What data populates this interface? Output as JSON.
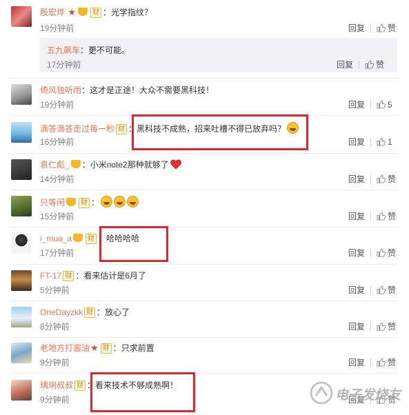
{
  "actions": {
    "reply": "回复",
    "like": "赞"
  },
  "comments": [
    {
      "user": "殷宏烨",
      "text": "光学指纹？",
      "time": "19分钟前",
      "likes": "赞",
      "reply": {
        "user": "五九飙车",
        "text": "更不可能。",
        "time": "17分钟前",
        "likes": "赞"
      }
    },
    {
      "user": "倚风独听雨",
      "text": "这才是正途！大众不需要黑科技！",
      "time": "19分钟前",
      "likes": "5"
    },
    {
      "user": "滴答滴答走过每一秒",
      "text": "黑科技不成熟，招来吐槽不得已放弃吗？",
      "time": "16分钟前",
      "likes": "1"
    },
    {
      "user": "袁仁彪_",
      "text": "小米note2那种就够了",
      "time": "14分钟前",
      "likes": "赞"
    },
    {
      "user": "只等闲",
      "text": "",
      "time": "15分钟前",
      "likes": "赞"
    },
    {
      "user": "i_mua_a",
      "text": "哈哈哈哈",
      "time": "17分钟前",
      "likes": "赞"
    },
    {
      "user": "FT-17",
      "text": "看来估计是6月了",
      "time": "5分钟前",
      "likes": "赞"
    },
    {
      "user": "OneDayzkk",
      "text": "放心了",
      "time": "8分钟前",
      "likes": "赞"
    },
    {
      "user": "老地方打酱油",
      "text": "只求前置",
      "time": "9分钟前",
      "likes": "赞"
    },
    {
      "user": "瑀琍叔叔",
      "text": "看来技术不够成熟啊！",
      "time": "9分钟前",
      "likes": "赞"
    }
  ],
  "badge_label": "财",
  "separator": "：",
  "watermark": "电子发烧友"
}
